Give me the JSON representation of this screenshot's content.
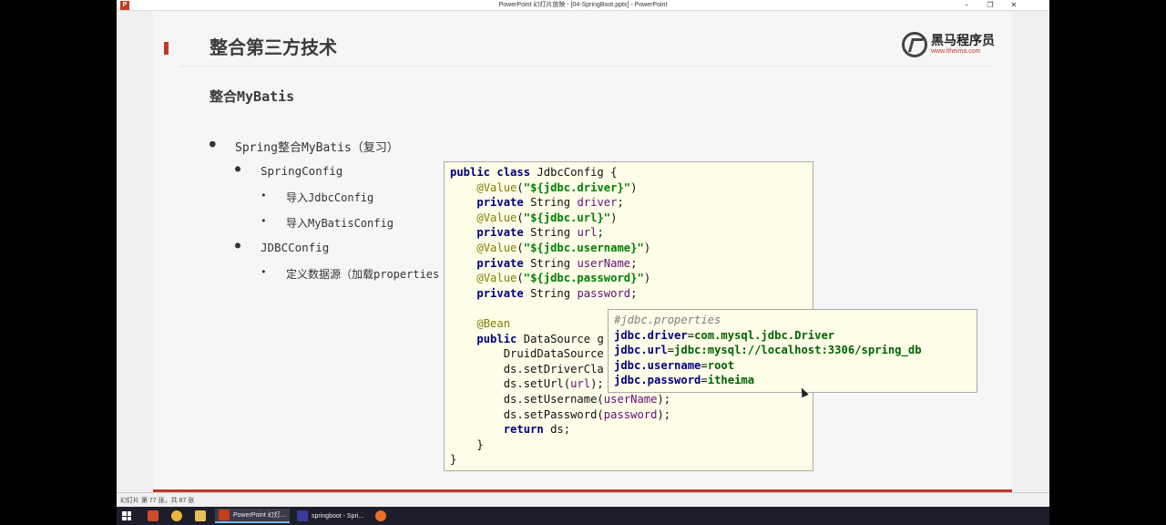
{
  "window": {
    "title": "PowerPoint 幻灯片放映 - [04-SpringBoot.pptx] - PowerPoint",
    "app_icon": "P"
  },
  "slide": {
    "title": "整合第三方技术",
    "subtitle": "整合MyBatis",
    "logo": {
      "name": "黑马程序员",
      "url": "www.itheima.com"
    },
    "bullets": {
      "b1": "Spring整合MyBatis（复习）",
      "b1_1": "SpringConfig",
      "b1_1_1": "导入JdbcConfig",
      "b1_1_2": "导入MyBatisConfig",
      "b1_2": "JDBCConfig",
      "b1_2_1": "定义数据源（加载properties"
    },
    "code": {
      "class_decl_kw": "public class",
      "class_decl_name": " JdbcConfig {",
      "ann_value": "@Value",
      "driver_key": "\"${jdbc.driver}\"",
      "url_key": "\"${jdbc.url}\"",
      "username_key": "\"${jdbc.username}\"",
      "password_key": "\"${jdbc.password}\"",
      "private_kw": "private",
      "string_type": " String ",
      "driver": "driver",
      "url": "url",
      "userName": "userName",
      "password": "password",
      "bean_ann": "@Bean",
      "public_kw": "public",
      "ds_decl": " DataSource g",
      "druid": "DruidDataSource",
      "set_driver": "ds.setDriverCla",
      "set_url": "ds.setUrl(",
      "set_url_end": ");",
      "set_username": "ds.setUsername(",
      "set_username_end": ");",
      "set_password": "ds.setPassword(",
      "set_password_end": ");",
      "return_kw": "return",
      "return_rest": " ds;",
      "close_method": "}",
      "close_class": "}"
    },
    "properties": {
      "comment": "#jdbc.properties",
      "lines": [
        {
          "key": "jdbc.driver",
          "value": "com.mysql.jdbc.Driver"
        },
        {
          "key": "jdbc.url",
          "value": "jdbc:mysql://localhost:3306/spring_db"
        },
        {
          "key": "jdbc.username",
          "value": "root"
        },
        {
          "key": "jdbc.password",
          "value": "itheima"
        }
      ]
    }
  },
  "statusbar": {
    "text": "幻灯片 第 77 张，共 87 张"
  },
  "taskbar": {
    "powerpoint_label": "PowerPoint 幻灯...",
    "idea_label": "springboot - Spri..."
  },
  "colors": {
    "accent": "#c0392b",
    "code_bg": "#fdfde8",
    "keyword": "#000080",
    "string": "#008000"
  }
}
